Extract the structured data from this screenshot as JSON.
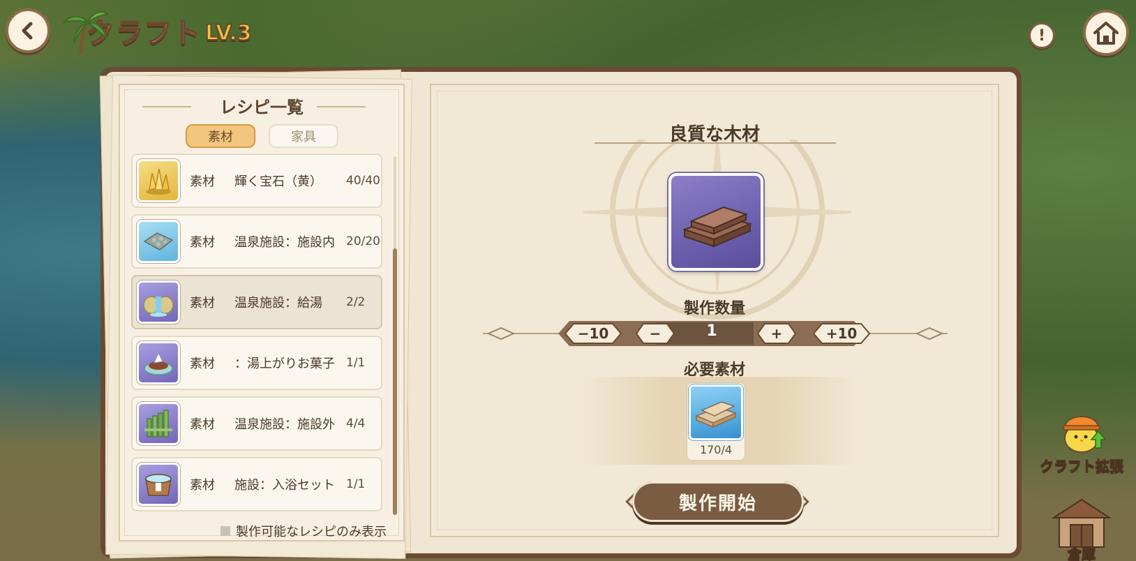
{
  "header": {
    "title": "クラフト",
    "level": "LV.3",
    "back_icon": "chevron-left-icon",
    "info_icon": "exclamation-icon",
    "home_icon": "home-icon"
  },
  "recipe_list": {
    "title": "レシピ一覧",
    "tabs": [
      {
        "label": "素材",
        "active": true
      },
      {
        "label": "家具",
        "active": false
      }
    ],
    "items": [
      {
        "category": "素材",
        "name": "輝く宝石（黄）",
        "count": "40/40",
        "icon": "gem-icon",
        "icon_color": "#e9c24a",
        "selected": false
      },
      {
        "category": "素材",
        "name": "温泉施設：施設内",
        "count": "20/20",
        "icon": "stone-tile-icon",
        "icon_color": "#7fc6e6",
        "selected": false
      },
      {
        "category": "素材",
        "name": "温泉施設：給湯",
        "count": "2/2",
        "icon": "waterfall-rock-icon",
        "icon_color": "#8b80c9",
        "selected": true
      },
      {
        "category": "素材",
        "name": "：湯上がりお菓子",
        "count": "1/1",
        "icon": "sweets-icon",
        "icon_color": "#8b80c9",
        "selected": false
      },
      {
        "category": "素材",
        "name": "温泉施設：施設外",
        "count": "4/4",
        "icon": "bamboo-fence-icon",
        "icon_color": "#8b80c9",
        "selected": false
      },
      {
        "category": "素材",
        "name": "施設：入浴セット",
        "count": "1/1",
        "icon": "bath-tub-icon",
        "icon_color": "#8b80c9",
        "selected": false
      }
    ],
    "filter_label": "製作可能なレシピのみ表示"
  },
  "detail": {
    "item_name": "良質な木材",
    "item_icon": "wood-plank-icon",
    "quantity_label": "製作数量",
    "quantity_buttons": {
      "minus10": "−10",
      "minus": "−",
      "plus": "+",
      "plus10": "+10"
    },
    "quantity_value": "1",
    "required_label": "必要素材",
    "required_items": [
      {
        "icon": "lumber-icon",
        "count": "170/4"
      }
    ],
    "craft_button": "製作開始"
  },
  "side": {
    "expand_label": "クラフト拡張",
    "warehouse_label": "倉庫"
  },
  "colors": {
    "frame_brown": "#6b4a32",
    "paper": "#f1e8d6",
    "tab_active": "#f2c67c",
    "item_purple": "#6e62b0",
    "item_blue": "#57ade3"
  }
}
